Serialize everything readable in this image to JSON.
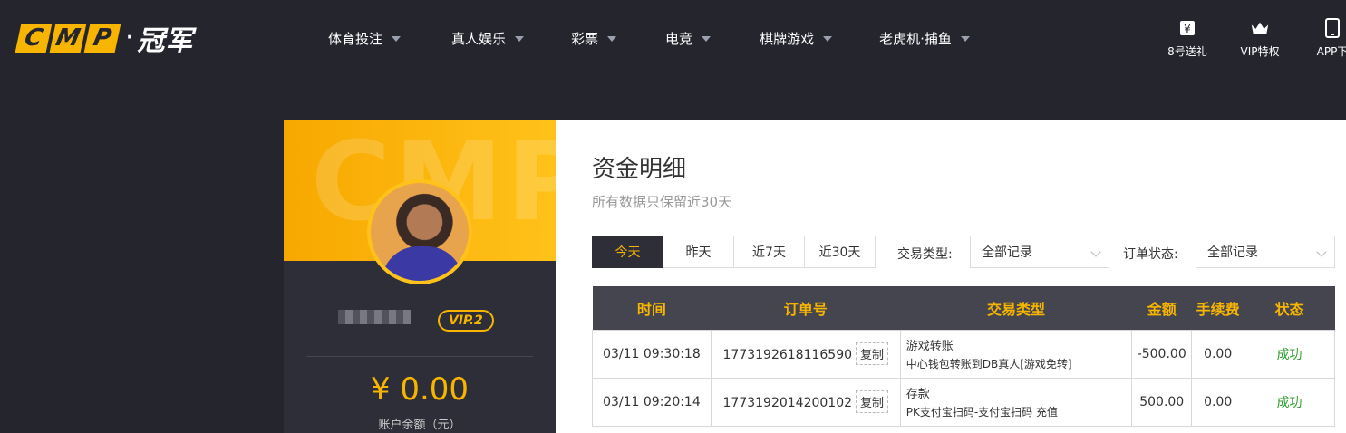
{
  "header": {
    "logo_letters": [
      "C",
      "M",
      "P"
    ],
    "logo_dot": "·",
    "logo_cn": "冠军",
    "nav": [
      {
        "label": "体育投注"
      },
      {
        "label": "真人娱乐"
      },
      {
        "label": "彩票"
      },
      {
        "label": "电竞"
      },
      {
        "label": "棋牌游戏"
      },
      {
        "label": "老虎机·捕鱼"
      }
    ],
    "tools": [
      {
        "label": "8号送礼",
        "icon": "gift-icon"
      },
      {
        "label": "VIP特权",
        "icon": "crown-icon"
      },
      {
        "label": "APP下",
        "icon": "phone-icon"
      }
    ]
  },
  "profile": {
    "watermark": "CMP",
    "vip": "VIP.2",
    "balance": "¥ 0.00",
    "balance_label": "账户余额（元）"
  },
  "main": {
    "title": "资金明细",
    "subtitle": "所有数据只保留近30天",
    "tabs": [
      {
        "label": "今天",
        "active": true
      },
      {
        "label": "昨天"
      },
      {
        "label": "近7天"
      },
      {
        "label": "近30天"
      }
    ],
    "filters": {
      "type_label": "交易类型:",
      "type_value": "全部记录",
      "status_label": "订单状态:",
      "status_value": "全部记录"
    },
    "table": {
      "headers": [
        "时间",
        "订单号",
        "交易类型",
        "金额",
        "手续费",
        "状态"
      ],
      "copy_label": "复制",
      "rows": [
        {
          "time": "03/11 09:30:18",
          "order": "1773192618116590",
          "type": "游戏转账",
          "type_detail": "中心钱包转账到DB真人[游戏免转]",
          "amount": "-500.00",
          "fee": "0.00",
          "status": "成功"
        },
        {
          "time": "03/11 09:20:14",
          "order": "1773192014200102",
          "type": "存款",
          "type_detail": "PK支付宝扫码-支付宝扫码 充值",
          "amount": "500.00",
          "fee": "0.00",
          "status": "成功"
        }
      ]
    }
  },
  "colors": {
    "accent": "#f7b500",
    "dark": "#24252d",
    "success": "#2e9e2e"
  }
}
